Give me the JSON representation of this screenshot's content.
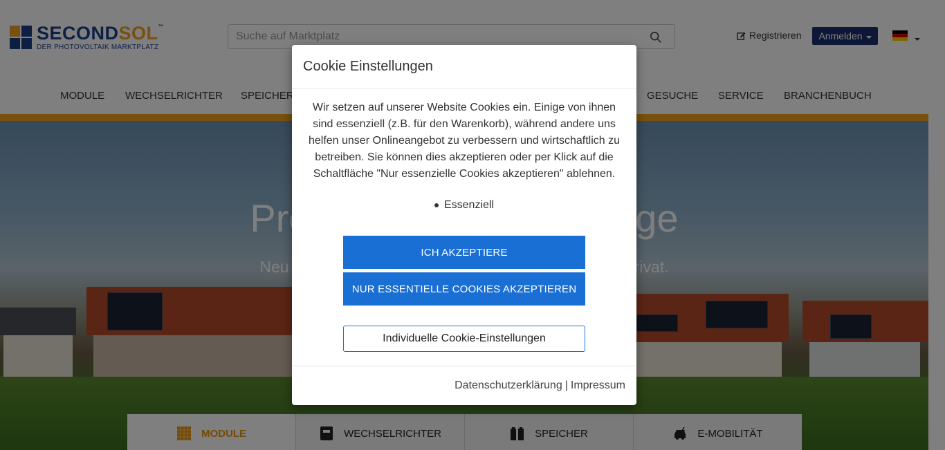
{
  "header": {
    "logo": {
      "word_a": "SECOND",
      "word_b": "SOL",
      "tm": "™",
      "tagline": "DER PHOTOVOLTAIK MARKTPLATZ"
    },
    "search": {
      "placeholder": "Suche auf Marktplatz",
      "value": "",
      "icon": "search-icon"
    },
    "register_label": "Registrieren",
    "login_label": "Anmelden",
    "language": "de",
    "nav": [
      "MODULE",
      "WECHSELRICHTER",
      "SPEICHER",
      "GESUCHE",
      "SERVICE",
      "BRANCHENBUCH"
    ]
  },
  "hero": {
    "title_left": "Prod",
    "title_right": "lage",
    "subtitle_left": "Neu o",
    "subtitle_right": "rivat."
  },
  "categories": [
    {
      "label": "MODULE",
      "icon": "solar-module-icon",
      "active": true
    },
    {
      "label": "WECHSELRICHTER",
      "icon": "inverter-icon",
      "active": false
    },
    {
      "label": "SPEICHER",
      "icon": "battery-icon",
      "active": false
    },
    {
      "label": "E-MOBILITÄT",
      "icon": "ev-car-icon",
      "active": false
    }
  ],
  "cookie_modal": {
    "title": "Cookie Einstellungen",
    "text": "Wir setzen auf unserer Website Cookies ein. Einige von ihnen sind essenziell (z.B. für den Warenkorb), während andere uns helfen unser Onlineangebot zu verbessern und wirtschaftlich zu betreiben. Sie können dies akzeptieren oder per Klick auf die Schaltfläche \"Nur essenzielle Cookies akzeptieren\" ablehnen.",
    "categories": [
      "Essenziell"
    ],
    "accept_label": "Ich akzeptiere",
    "essential_label": "Nur essentielle Cookies akzeptieren",
    "individual_label": "Individuelle Cookie-Einstellungen",
    "privacy_label": "Datenschutzerklärung",
    "separator": "|",
    "imprint_label": "Impressum"
  },
  "colors": {
    "brand_blue": "#1c3e8c",
    "brand_orange": "#f0a01e",
    "button_blue": "#1a6fd4",
    "login_navy": "#1c2e6e"
  }
}
